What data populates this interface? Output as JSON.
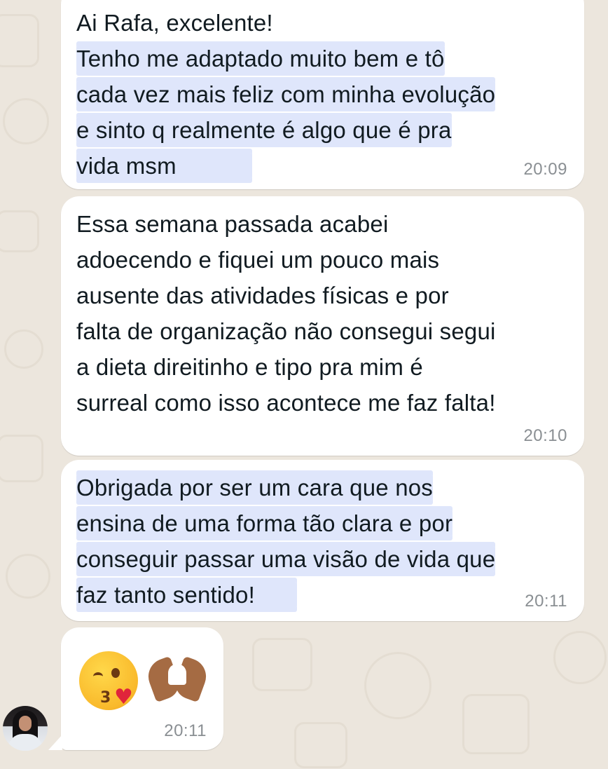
{
  "messages": [
    {
      "lines": [
        {
          "text": "Ai Rafa, excelente!",
          "highlight": false
        },
        {
          "text": "Tenho me adaptado muito bem e tô",
          "highlight": true
        },
        {
          "text": "cada vez mais feliz com minha evolução",
          "highlight": true
        },
        {
          "text": "e sinto q realmente é algo que é pra",
          "highlight": true
        },
        {
          "text": "vida msm",
          "highlight": true
        }
      ],
      "time": "20:09"
    },
    {
      "lines": [
        {
          "text": "Essa semana passada acabei",
          "highlight": false
        },
        {
          "text": "adoecendo e fiquei um pouco mais",
          "highlight": false
        },
        {
          "text": "ausente das atividades físicas e por",
          "highlight": false
        },
        {
          "text": "falta de organização não consegui segui",
          "highlight": false
        },
        {
          "text": "a dieta direitinho e tipo pra mim é",
          "highlight": false
        },
        {
          "text": "surreal como isso acontece me faz falta!",
          "highlight": false
        }
      ],
      "time": "20:10"
    },
    {
      "lines": [
        {
          "text": "Obrigada por ser um cara que nos",
          "highlight": true
        },
        {
          "text": "ensina de uma forma tão clara e por",
          "highlight": true
        },
        {
          "text": "conseguir passar uma visão de vida que",
          "highlight": true
        },
        {
          "text": "faz tanto sentido!",
          "highlight": true
        }
      ],
      "time": "20:11"
    },
    {
      "emojis": [
        "kissing-face-with-heart-emoji",
        "heart-hands-emoji"
      ],
      "time": "20:11"
    }
  ],
  "colors": {
    "chat_background": "#ece6dd",
    "bubble": "#ffffff",
    "highlight": "#dfe6fb",
    "text": "#111b21",
    "timestamp": "#8a8f93"
  },
  "sender_avatar": "contact-avatar"
}
